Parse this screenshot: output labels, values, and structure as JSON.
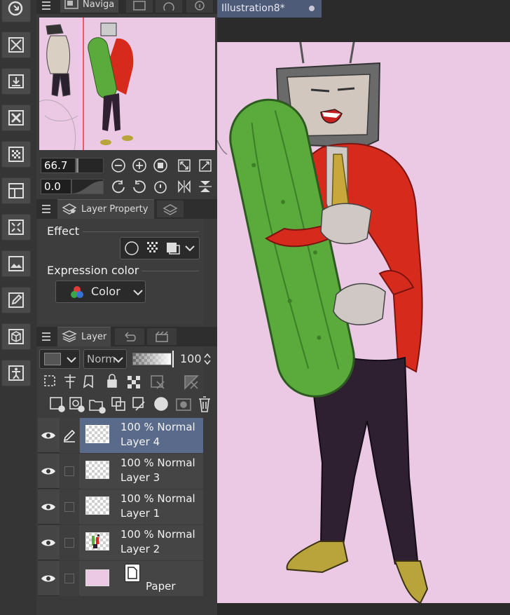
{
  "document_tab": {
    "title": "Illustration8*"
  },
  "navigator": {
    "tab_label": "Naviga",
    "zoom_value": "66.7",
    "rotation_value": "0.0"
  },
  "layer_property": {
    "tab_label": "Layer Property",
    "effect_label": "Effect",
    "expression_color_label": "Expression color",
    "expression_color_value": "Color"
  },
  "layer_panel": {
    "tab_label": "Layer",
    "blend_mode": "Norm",
    "opacity_value": "100",
    "layers": [
      {
        "line1": "100 % Normal",
        "line2": "Layer 4",
        "selected": true
      },
      {
        "line1": "100 % Normal",
        "line2": "Layer 3",
        "selected": false
      },
      {
        "line1": "100 % Normal",
        "line2": "Layer 1",
        "selected": false
      },
      {
        "line1": "100 % Normal",
        "line2": "Layer 2",
        "selected": false
      },
      {
        "line1": "",
        "line2": "Paper",
        "selected": false
      }
    ]
  },
  "colors": {
    "paper": "#ebc8e4",
    "selected_layer": "#5a6a8a",
    "document_tab": "#4d5a78",
    "jacket": "#d62a1c",
    "cucumber": "#5aaa3c",
    "trousers": "#2e2030"
  }
}
